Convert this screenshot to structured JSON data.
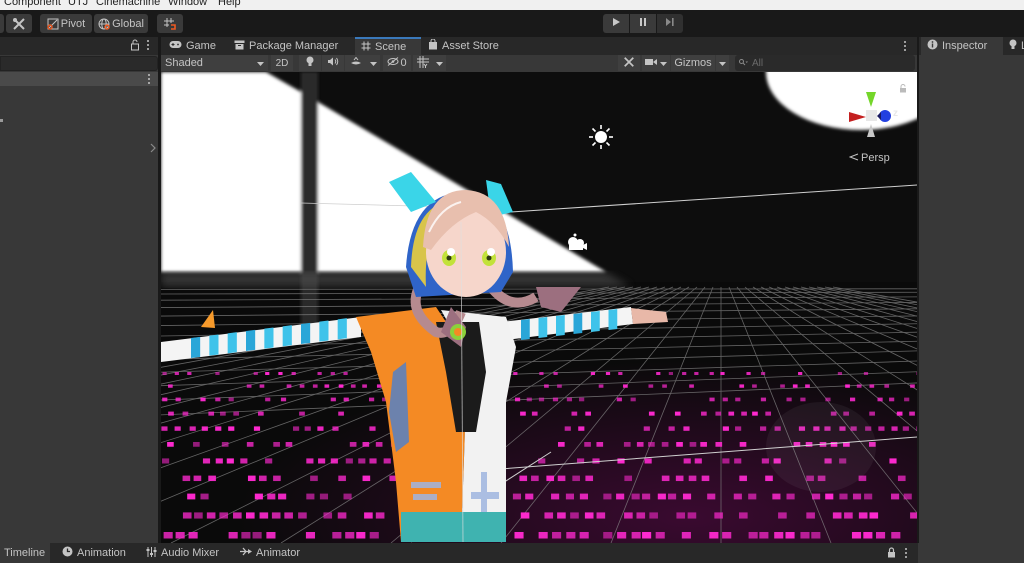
{
  "menubar": {
    "items": [
      "Component",
      "UTJ",
      "Cinemachine",
      "Window",
      "Help"
    ]
  },
  "toolbar": {
    "pivot_label": "Pivot",
    "global_label": "Global",
    "play_icon": "play-icon",
    "pause_icon": "pause-icon",
    "step_icon": "step-icon"
  },
  "scene_tabs": [
    {
      "label": "Game",
      "icon": "gamepad-icon"
    },
    {
      "label": "Package Manager",
      "icon": "package-icon"
    },
    {
      "label": "Scene",
      "icon": "hash-icon",
      "active": true
    },
    {
      "label": "Asset Store",
      "icon": "bag-icon"
    }
  ],
  "scene_toolbar": {
    "shading_mode": "Shaded",
    "mode_2d": "2D",
    "hidden_count": "0",
    "gizmos_label": "Gizmos",
    "search_placeholder": "All"
  },
  "viewport": {
    "projection_label": "Persp",
    "axis_z_label": "z",
    "colors": {
      "axis_x": "#c42020",
      "axis_y": "#74d62a",
      "axis_z": "#2340e0",
      "floor_dots": "#ff29d0",
      "grid": "#8a8a8a"
    }
  },
  "right_panel": {
    "tabs": [
      {
        "label": "Inspector",
        "icon": "info-icon",
        "active": true
      },
      {
        "label": "L",
        "icon": "lightbulb-icon"
      }
    ]
  },
  "bottom_tabs": [
    {
      "label": "Timeline",
      "active": true
    },
    {
      "label": "Animation",
      "icon": "clock-icon"
    },
    {
      "label": "Audio Mixer",
      "icon": "mixer-icon"
    },
    {
      "label": "Animator",
      "icon": "animator-icon"
    }
  ]
}
